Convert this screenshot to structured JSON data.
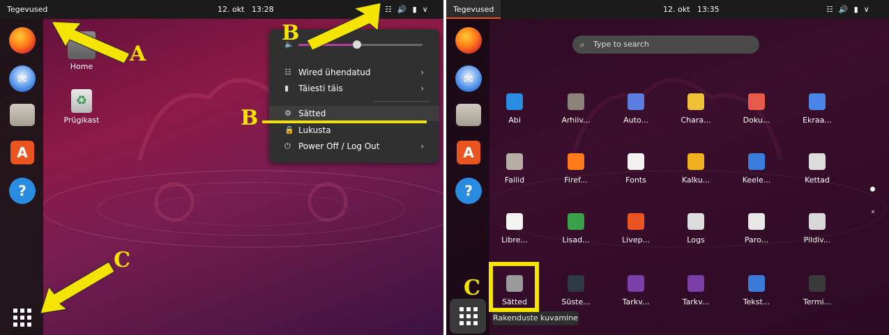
{
  "left": {
    "topbar": {
      "activities": "Tegevused",
      "date": "12. okt",
      "time": "13:28"
    },
    "desktop": {
      "home": "Home",
      "trash": "Prügikast"
    },
    "menu": {
      "wired": "Wired ühendatud",
      "battery": "Täiesti täis",
      "settings": "Sätted",
      "lock": "Lukusta",
      "power": "Power Off / Log Out",
      "volume_level": 0.47
    }
  },
  "right": {
    "topbar": {
      "activities": "Tegevused",
      "date": "12. okt",
      "time": "13:35"
    },
    "search_placeholder": "Type to search",
    "apps": [
      {
        "label": "Abi",
        "icon": "help-icon",
        "color": "#2a8ce0"
      },
      {
        "label": "Arhiiv...",
        "icon": "archive-icon",
        "color": "#8c8478"
      },
      {
        "label": "Auto...",
        "icon": "window-icon",
        "color": "#5b7fe0"
      },
      {
        "label": "Chara...",
        "icon": "character-map-icon",
        "color": "#f0c038"
      },
      {
        "label": "Doku...",
        "icon": "document-icon",
        "color": "#e65a4a"
      },
      {
        "label": "Ekraa...",
        "icon": "screenshot-icon",
        "color": "#4a86e8"
      },
      {
        "label": "Failid",
        "icon": "folder-icon",
        "color": "#b5aea3"
      },
      {
        "label": "Firef...",
        "icon": "firefox-icon",
        "color": "#ff7a1a"
      },
      {
        "label": "Fonts",
        "icon": "font-icon",
        "color": "#f2f2f2"
      },
      {
        "label": "Kalku...",
        "icon": "calculator-icon",
        "color": "#f0b020"
      },
      {
        "label": "Keele...",
        "icon": "language-icon",
        "color": "#3b7ddd"
      },
      {
        "label": "Kettad",
        "icon": "disk-icon",
        "color": "#dddddd"
      },
      {
        "label": "Libre...",
        "icon": "libreoffice-icon",
        "color": "#f4f4f4"
      },
      {
        "label": "Lisad...",
        "icon": "chip-icon",
        "color": "#3aa04a"
      },
      {
        "label": "Livep...",
        "icon": "livepatch-icon",
        "color": "#e95420"
      },
      {
        "label": "Logs",
        "icon": "logs-icon",
        "color": "#dcdcdc"
      },
      {
        "label": "Paro...",
        "icon": "password-icon",
        "color": "#e8e8e8"
      },
      {
        "label": "Pildiv...",
        "icon": "image-viewer-icon",
        "color": "#d8d8d8"
      },
      {
        "label": "Sätted",
        "icon": "settings-gear-icon",
        "color": "#9a9a9a"
      },
      {
        "label": "Süste...",
        "icon": "system-monitor-icon",
        "color": "#2e3a46"
      },
      {
        "label": "Tarkv...",
        "icon": "software-icon",
        "color": "#7a3fa8"
      },
      {
        "label": "Tarkv...",
        "icon": "software-updater-icon",
        "color": "#7a3fa8"
      },
      {
        "label": "Tekst...",
        "icon": "text-editor-icon",
        "color": "#3a7ad8"
      },
      {
        "label": "Termi...",
        "icon": "terminal-icon",
        "color": "#3a3a3a"
      }
    ],
    "tooltip": "Rakenduste kuvamine"
  },
  "annotations": {
    "a": "A",
    "b": "B",
    "b2": "B",
    "c": "C",
    "c2": "C"
  },
  "colors": {
    "annotation": "#f5e400",
    "ubuntu_orange": "#e95420"
  }
}
